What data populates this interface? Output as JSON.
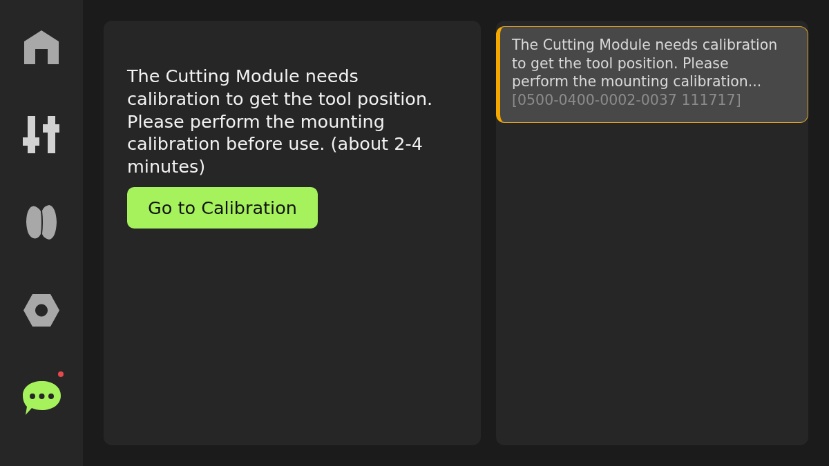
{
  "sidebar": {
    "items": [
      {
        "kind": "home",
        "selected": false,
        "unread": false
      },
      {
        "kind": "controls",
        "selected": false,
        "unread": false
      },
      {
        "kind": "spool",
        "selected": false,
        "unread": false
      },
      {
        "kind": "settings",
        "selected": false,
        "unread": false
      },
      {
        "kind": "messages",
        "selected": true,
        "unread": true
      }
    ]
  },
  "detail": {
    "message": "The Cutting Module needs calibration to get the tool position. Please perform the mounting calibration before use. (about 2-4 minutes)",
    "button": "Go to Calibration"
  },
  "notifications": [
    {
      "kind": "warning",
      "selected": true,
      "text": "The Cutting Module needs calibration to get the tool position. Please perform the mounting calibration...",
      "code": "[0500-0400-0002-0037 111717]"
    }
  ]
}
